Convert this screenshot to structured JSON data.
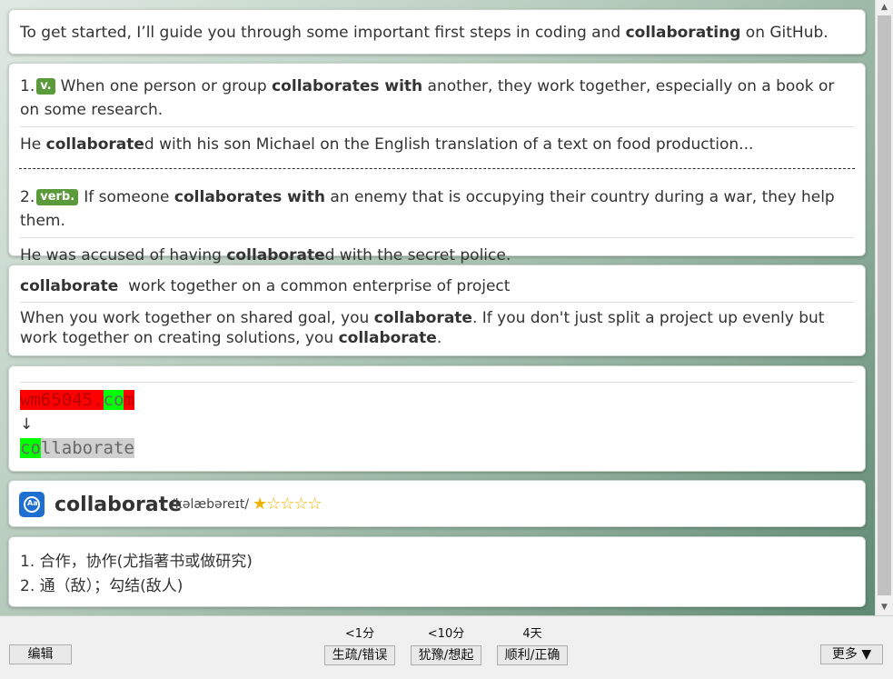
{
  "intro": {
    "pre": "To get started, I’ll guide you through some important first steps in coding and ",
    "bold": "collaborating",
    "post": " on GitHub."
  },
  "definitions": [
    {
      "num": "1.",
      "tag": "v.",
      "pre": "When one person or group ",
      "bold": "collaborates with",
      "post": " another, they work together, especially on a book or on some research.",
      "ex_pre": "He ",
      "ex_bold": "collaborate",
      "ex_post": "d with his son Michael on the English translation of a text on food production..."
    },
    {
      "num": "2.",
      "tag": "verb.",
      "pre": "If someone ",
      "bold": "collaborates with",
      "post": " an enemy that is occupying their country during a war, they help them.",
      "ex_pre": "He was accused of having ",
      "ex_bold": "collaborate",
      "ex_post": "d with the secret police."
    }
  ],
  "note": {
    "word": "collaborate",
    "gloss": "work together on a common enterprise of project",
    "t1": "When you work together on shared goal, you ",
    "b1": "collaborate",
    "t2": ". If you don't just split a project up evenly but work together on creating solutions, you ",
    "b2": "collaborate",
    "t3": "."
  },
  "mnemonic": {
    "from_red": "wm65045.",
    "from_green": "co",
    "from_red_end": "m",
    "arrow": "↓",
    "to_green": "co",
    "to_gray": "llaborate"
  },
  "header": {
    "word": "collaborate",
    "phonetic": "/kəlæbəreɪt/",
    "stars": "★☆☆☆☆",
    "icon": "dictionary-app-icon"
  },
  "chinese": {
    "line1": "1. 合作，协作(尤指著书或做研究)",
    "line2": "2. 通（敌）；勾结(敌人)"
  },
  "bottom": {
    "edit": "编辑",
    "more": "更多 ▼",
    "choices": [
      {
        "interval": "<1分",
        "label": "生疏/错误"
      },
      {
        "interval": "<10分",
        "label": "犹豫/想起"
      },
      {
        "interval": "4天",
        "label": "顺利/正确"
      }
    ]
  },
  "colors": {
    "tag_bg": "#5a9a3a",
    "accent_blue": "#1e6fd0"
  }
}
